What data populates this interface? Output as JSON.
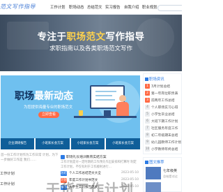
{
  "logo": {
    "text": "范文写作指导"
  },
  "nav": {
    "items": [
      {
        "label": "工作计划"
      },
      {
        "label": "职场动态"
      },
      {
        "label": "总结范文"
      },
      {
        "label": "实习报告"
      },
      {
        "label": "自我介绍"
      },
      {
        "label": "职业规划"
      }
    ]
  },
  "hero": {
    "title_prefix": "专注于",
    "title_highlight": "职场范文",
    "title_suffix": "写作指导",
    "subtitle": "求职指南以及各类职场范文写作"
  },
  "banner": {
    "title_part1": "职场",
    "title_part2": "最新动态",
    "subtitle": "为您提供海量专业的职场范文",
    "button": "立即查看"
  },
  "thumbs": [
    {
      "label": "企业调研报告"
    },
    {
      "label": "小班家长会方案"
    },
    {
      "label": "小班家长会方案"
    },
    {
      "label": "小班家长会方案"
    }
  ],
  "article": {
    "left_text": "首一份工作计划作为工作日常 计划，为下一步做好工作是 我们……",
    "title": "职场礼仪培训教育实结方案",
    "text": "工作计划是对一定时期的工作预先作出安排和打算时 制定工作计划，不仅有利于工作顺利进行…",
    "left_items": [
      {
        "label": "工作计划"
      },
      {
        "label": "工作计划"
      }
    ],
    "list": [
      {
        "badge": "总结",
        "text": "个人工作总结范文大全",
        "date": "2023-05-10"
      },
      {
        "badge": "计划",
        "text": "年度工作计划书范文",
        "date": "2023-05-10"
      },
      {
        "badge": "报告",
        "text": "大学生实习报告范文",
        "date": "2023-05-10"
      }
    ]
  },
  "sidebar": {
    "heading": "职场资讯",
    "items": [
      {
        "num": "1",
        "text": "3月计划总结"
      },
      {
        "num": "2",
        "text": "第一年岗位职责表"
      },
      {
        "num": "3",
        "text": "前两年工作总结"
      },
      {
        "num": "4",
        "text": "个人职场实习心得"
      },
      {
        "num": "5",
        "text": "小学生毕业总结"
      },
      {
        "num": "6",
        "text": "大班下期工作计划"
      },
      {
        "num": "7",
        "text": "社区服务年度工作"
      },
      {
        "num": "8",
        "text": "初二年级期末总结"
      },
      {
        "num": "9",
        "text": "幼儿园教师工作计划"
      },
      {
        "num": "10",
        "text": "小学教师年终总结"
      }
    ]
  },
  "recommend": {
    "heading": "图文推荐",
    "title": "七年级英",
    "desc": "总结是对过"
  },
  "watermark": {
    "text": "干货工作计划"
  },
  "colors": {
    "accent": "#2c7be5",
    "banner": "#6fc0ef",
    "thumb": "#0f5e99",
    "highlight": "#ffd24d",
    "hot": "#ff6a45"
  }
}
